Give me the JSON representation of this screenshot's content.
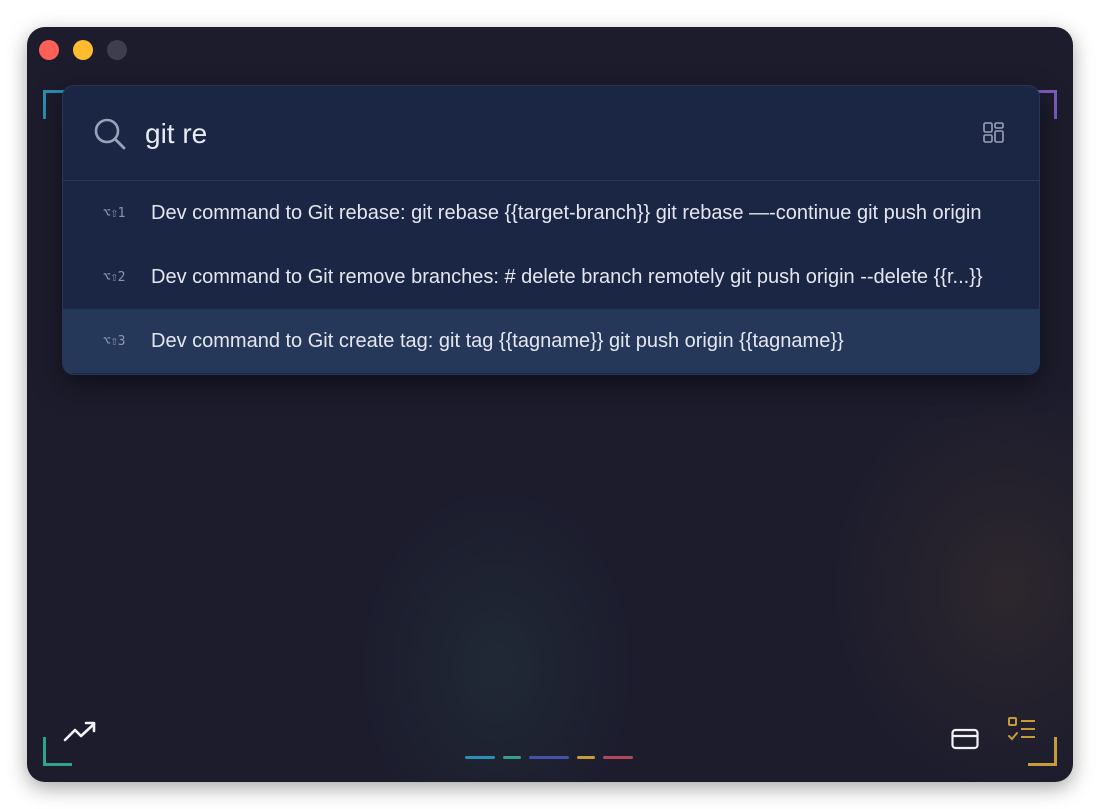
{
  "search": {
    "query": "git re"
  },
  "results": [
    {
      "shortcut": "⌥⇧1",
      "text": "Dev command to Git rebase: git rebase {{target-branch}} git rebase —-continue git push origin"
    },
    {
      "shortcut": "⌥⇧2",
      "text": "Dev command to Git remove branches: # delete branch remotely git push origin --delete {{r...}}"
    },
    {
      "shortcut": "⌥⇧3",
      "text": "Dev command to Git create tag: git tag {{tagname}} git push origin {{tagname}}"
    }
  ],
  "selected_index": 2,
  "icons": {
    "search": "search-icon",
    "view_toggle": "grid-icon",
    "trend": "trending-up-icon",
    "card": "card-icon",
    "checklist": "checklist-icon"
  },
  "colors": {
    "window_bg": "#1c1c2d",
    "palette_bg": "#1b2644",
    "selected_row": "#26385a",
    "corner_top_left": "#2a8fb0",
    "corner_top_right": "#7c5cc0",
    "corner_bottom_left": "#2fa38a",
    "corner_bottom_right": "#c79a3a",
    "close": "#fe5f57",
    "minimize": "#febc2e",
    "maximize": "#3e3e4e"
  },
  "page_indicator": [
    "#2a8fb0",
    "#2fa38a",
    "#4353a8",
    "#c79a3a",
    "#b0485a"
  ]
}
